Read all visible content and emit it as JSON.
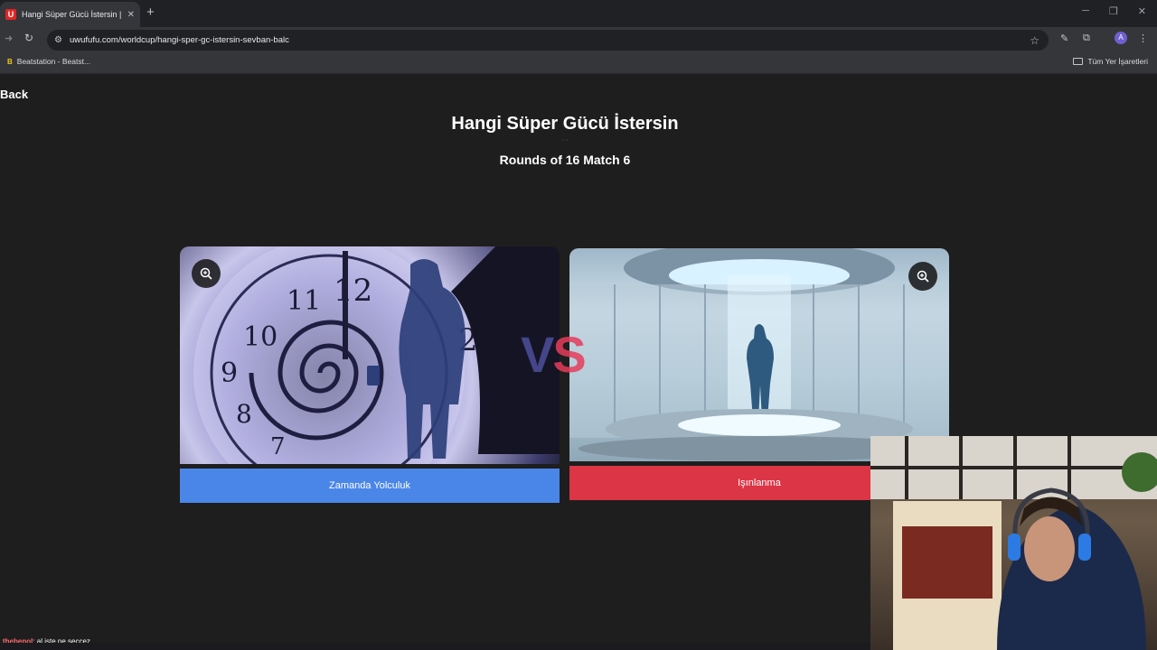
{
  "browser": {
    "tab_favicon": "U",
    "tab_title": "Hangi Süper Gücü İstersin | Uw",
    "url": "uwufufu.com/worldcup/hangi-sper-gc-istersin-sevban-balc",
    "profile_initial": "A",
    "bookmark_label": "Beatstation - Beatst...",
    "bookmark_favicon": "B",
    "all_bookmarks_label": "Tüm Yer İşaretleri"
  },
  "page": {
    "back_label": "Back",
    "title": "Hangi Süper Gücü İstersin",
    "title_dots": "···",
    "round_label": "Rounds of 16 Match 6",
    "vs_v": "V",
    "vs_s": "S"
  },
  "choices": [
    {
      "label": "Zamanda Yolculuk",
      "image": "time-travel-clock-image",
      "color": "#4a86e8"
    },
    {
      "label": "Işınlanma",
      "image": "teleportation-chamber-image",
      "color": "#dc3545"
    }
  ],
  "chat": {
    "user": "thebenol",
    "message": ": al iste ne seccez"
  }
}
